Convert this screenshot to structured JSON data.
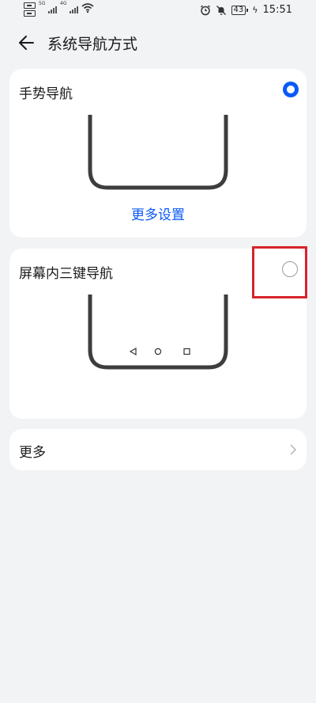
{
  "status_bar": {
    "signal1_tag": "5G",
    "signal2_tag": "4G",
    "battery": "43",
    "time": "15:51"
  },
  "header": {
    "title": "系统导航方式"
  },
  "options": [
    {
      "label": "手势导航",
      "selected": true,
      "link_label": "更多设置"
    },
    {
      "label": "屏幕内三键导航",
      "selected": false
    }
  ],
  "more": {
    "label": "更多"
  },
  "colors": {
    "accent": "#0a59f7",
    "highlight": "#d8232a",
    "background": "#f1f3f5"
  }
}
